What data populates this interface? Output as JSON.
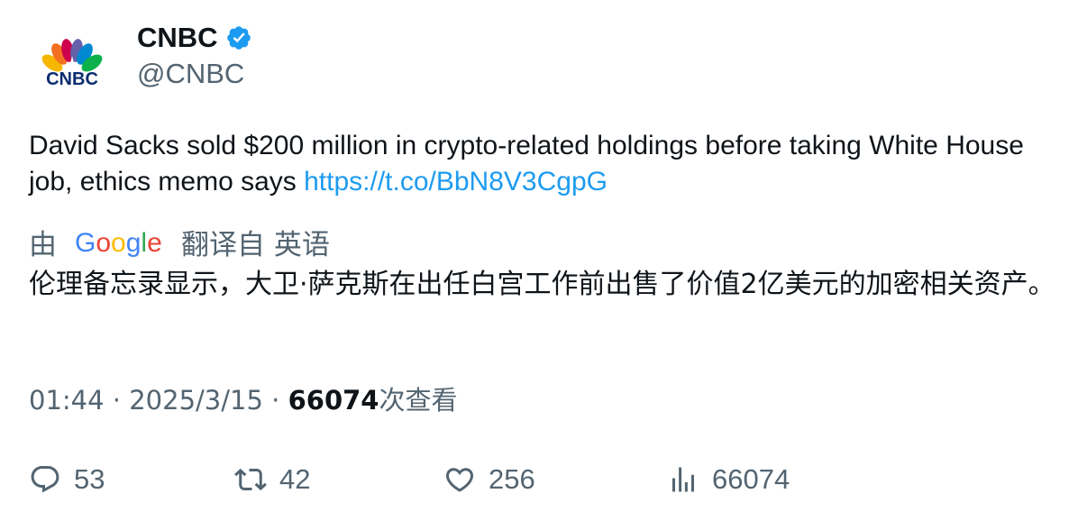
{
  "author": {
    "display_name": "CNBC",
    "handle": "@CNBC",
    "verified": true,
    "avatar_logo_text": "CNBC"
  },
  "tweet": {
    "text": "David Sacks sold $200 million in crypto-related holdings before taking White House job, ethics memo says ",
    "link": "https://t.co/BbN8V3CgpG"
  },
  "translation": {
    "prefix": "由",
    "provider": "Google",
    "suffix": "翻译自 英语",
    "text": "伦理备忘录显示，大卫·萨克斯在出任白宫工作前出售了价值2亿美元的加密相关资产。"
  },
  "meta": {
    "time": "01:44",
    "separator": "·",
    "date": "2025/3/15",
    "views": "66074",
    "views_label": "次查看"
  },
  "actions": {
    "replies": "53",
    "retweets": "42",
    "likes": "256",
    "views": "66074"
  },
  "colors": {
    "text": "#0f1419",
    "secondary": "#536471",
    "link": "#1d9bf0",
    "verified": "#1d9bf0"
  },
  "icons": {
    "reply": "reply-icon",
    "retweet": "retweet-icon",
    "like": "heart-icon",
    "views": "views-chart-icon",
    "verified": "verified-badge-icon"
  }
}
